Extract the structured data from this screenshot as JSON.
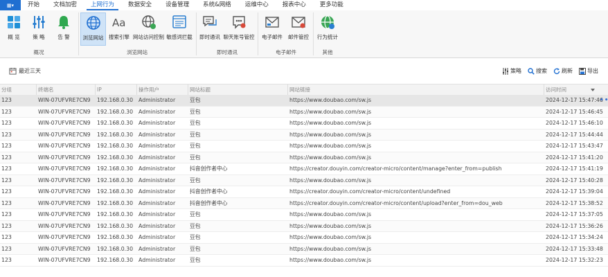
{
  "app_menu_icon": "menu-icon",
  "menu": [
    "开始",
    "文档加密",
    "上网行为",
    "数据安全",
    "设备管理",
    "系统&网络",
    "运维中心",
    "报表中心",
    "更多功能"
  ],
  "ribbon": {
    "buttons": [
      {
        "label": "概 览",
        "icon": "overview-grid-icon"
      },
      {
        "label": "策 略",
        "icon": "policy-sliders-icon"
      },
      {
        "label": "告 警",
        "icon": "bell-icon"
      },
      {
        "label": "浏览网站",
        "icon": "globe-icon"
      },
      {
        "label": "搜索引擎",
        "icon": "search-engine-icon"
      },
      {
        "label": "网站访问控制",
        "icon": "web-access-control-icon"
      },
      {
        "label": "敏感词拦截",
        "icon": "sensitive-word-icon"
      },
      {
        "label": "即时通讯",
        "icon": "instant-message-icon"
      },
      {
        "label": "聊天账号管控",
        "icon": "chat-account-icon"
      },
      {
        "label": "电子邮件",
        "icon": "email-icon"
      },
      {
        "label": "邮件管控",
        "icon": "mail-control-icon"
      },
      {
        "label": "行为统计",
        "icon": "behavior-stats-icon"
      }
    ],
    "groups": [
      "概况",
      "浏览网站",
      "即时通讯",
      "电子邮件",
      "其他"
    ]
  },
  "toolbar": {
    "range_label": "最近三天",
    "strategy_label": "策略",
    "search_label": "搜索",
    "refresh_label": "刷新",
    "export_label": "导出"
  },
  "table": {
    "columns": [
      "分组",
      "终端名",
      "IP",
      "操作用户",
      "网站标题",
      "网站链接",
      "访问时间"
    ],
    "rows": [
      [
        "123",
        "WIN-07UFVRE7CN9",
        "192.168.0.30",
        "Administrator",
        "豆包",
        "https://www.doubao.com/sw.js",
        "2024-12-17 15:47:46"
      ],
      [
        "123",
        "WIN-07UFVRE7CN9",
        "192.168.0.30",
        "Administrator",
        "豆包",
        "https://www.doubao.com/sw.js",
        "2024-12-17 15:46:45"
      ],
      [
        "123",
        "WIN-07UFVRE7CN9",
        "192.168.0.30",
        "Administrator",
        "豆包",
        "https://www.doubao.com/sw.js",
        "2024-12-17 15:46:10"
      ],
      [
        "123",
        "WIN-07UFVRE7CN9",
        "192.168.0.30",
        "Administrator",
        "豆包",
        "https://www.doubao.com/sw.js",
        "2024-12-17 15:44:44"
      ],
      [
        "123",
        "WIN-07UFVRE7CN9",
        "192.168.0.30",
        "Administrator",
        "豆包",
        "https://www.doubao.com/sw.js",
        "2024-12-17 15:43:47"
      ],
      [
        "123",
        "WIN-07UFVRE7CN9",
        "192.168.0.30",
        "Administrator",
        "豆包",
        "https://www.doubao.com/sw.js",
        "2024-12-17 15:41:20"
      ],
      [
        "123",
        "WIN-07UFVRE7CN9",
        "192.168.0.30",
        "Administrator",
        "抖音创作者中心",
        "https://creator.douyin.com/creator-micro/content/manage?enter_from=publish",
        "2024-12-17 15:41:19"
      ],
      [
        "123",
        "WIN-07UFVRE7CN9",
        "192.168.0.30",
        "Administrator",
        "豆包",
        "https://www.doubao.com/sw.js",
        "2024-12-17 15:40:28"
      ],
      [
        "123",
        "WIN-07UFVRE7CN9",
        "192.168.0.30",
        "Administrator",
        "抖音创作者中心",
        "https://creator.douyin.com/creator-micro/content/undefined",
        "2024-12-17 15:39:04"
      ],
      [
        "123",
        "WIN-07UFVRE7CN9",
        "192.168.0.30",
        "Administrator",
        "抖音创作者中心",
        "https://creator.douyin.com/creator-micro/content/upload?enter_from=dou_web",
        "2024-12-17 15:38:52"
      ],
      [
        "123",
        "WIN-07UFVRE7CN9",
        "192.168.0.30",
        "Administrator",
        "豆包",
        "https://www.doubao.com/sw.js",
        "2024-12-17 15:37:05"
      ],
      [
        "123",
        "WIN-07UFVRE7CN9",
        "192.168.0.30",
        "Administrator",
        "豆包",
        "https://www.doubao.com/sw.js",
        "2024-12-17 15:36:26"
      ],
      [
        "123",
        "WIN-07UFVRE7CN9",
        "192.168.0.30",
        "Administrator",
        "豆包",
        "https://www.doubao.com/sw.js",
        "2024-12-17 15:34:24"
      ],
      [
        "123",
        "WIN-07UFVRE7CN9",
        "192.168.0.30",
        "Administrator",
        "豆包",
        "https://www.doubao.com/sw.js",
        "2024-12-17 15:33:48"
      ],
      [
        "123",
        "WIN-07UFVRE7CN9",
        "192.168.0.30",
        "Administrator",
        "豆包",
        "https://www.doubao.com/sw.js",
        "2024-12-17 15:32:23"
      ]
    ],
    "row_more_icon": "more-dots-icon"
  },
  "colors": {
    "accent": "#1f6fd1",
    "selected_button": "#cfe3f7",
    "selected_row": "#e6e6e6"
  }
}
